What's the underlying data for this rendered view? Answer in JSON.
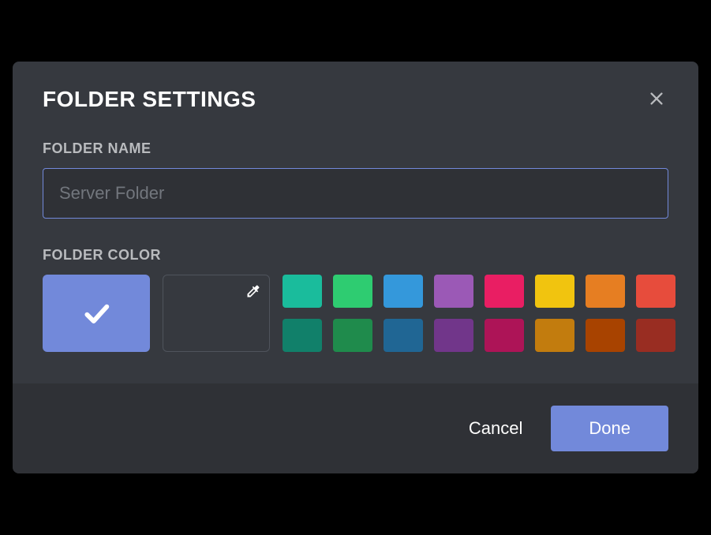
{
  "modal": {
    "title": "FOLDER SETTINGS",
    "folder_name_label": "FOLDER NAME",
    "folder_name_placeholder": "Server Folder",
    "folder_name_value": "",
    "folder_color_label": "FOLDER COLOR",
    "selected_color": "#7289da",
    "palette": [
      "#1abc9c",
      "#2ecc71",
      "#3498db",
      "#9b59b6",
      "#e91e63",
      "#f1c40f",
      "#e67e22",
      "#e74c3c",
      "#11806a",
      "#1f8b4c",
      "#206694",
      "#71368a",
      "#ad1457",
      "#c27c0e",
      "#a84300",
      "#992d22"
    ],
    "cancel_label": "Cancel",
    "done_label": "Done"
  }
}
